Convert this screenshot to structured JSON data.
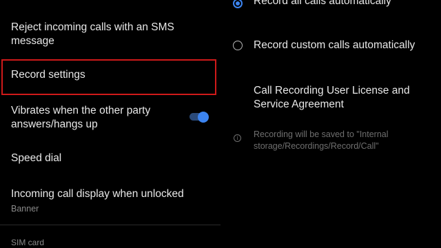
{
  "left_panel": {
    "items": [
      {
        "title": "Reject incoming calls with an SMS message"
      },
      {
        "title": "Record settings"
      },
      {
        "title": "Vibrates when the other party answers/hangs up",
        "toggle_on": true
      },
      {
        "title": "Speed dial"
      },
      {
        "title": "Incoming call display when unlocked",
        "subtitle": "Banner"
      }
    ],
    "section_label": "SIM card"
  },
  "right_panel": {
    "options": [
      {
        "label": "Record all calls automatically",
        "selected": true
      },
      {
        "label": "Record custom calls automatically",
        "selected": false
      }
    ],
    "license_link": "Call Recording User License and Service Agreement",
    "info_note": "Recording will be saved to \"Internal storage/Recordings/Record/Call\""
  },
  "colors": {
    "background": "#000000",
    "accent": "#3c84f0",
    "highlight_border": "#d01a1a",
    "secondary_text": "#8a8a8a"
  },
  "icons": {
    "info": "info-circle-icon"
  }
}
